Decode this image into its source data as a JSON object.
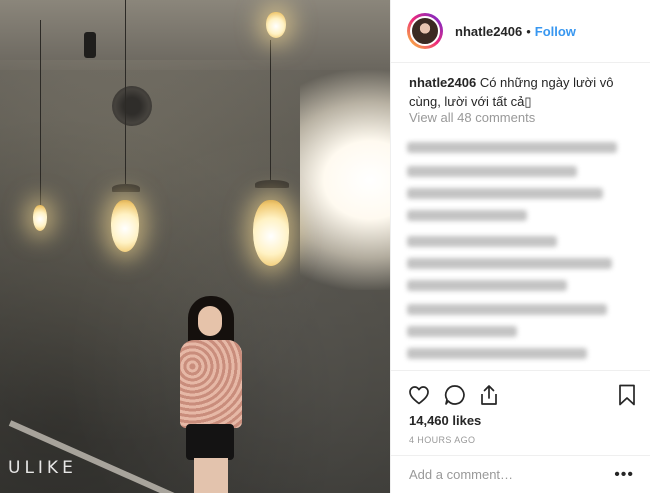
{
  "photo": {
    "watermark": "ULIKE"
  },
  "post": {
    "username": "nhatle2406",
    "separator": "•",
    "follow_label": "Follow",
    "caption_user": "nhatle2406",
    "caption_text": "Có những ngày lười vô cùng, lười với tất cả▯",
    "view_all_comments": "View all 48 comments",
    "likes": "14,460 likes",
    "posted_time": "4 HOURS AGO",
    "comment_placeholder": "Add a comment…",
    "more_label": "•••"
  },
  "icons": {
    "like": "heart-icon",
    "comment": "comment-bubble-icon",
    "share": "share-icon",
    "save": "bookmark-icon"
  },
  "colors": {
    "follow": "#3897f0",
    "muted": "#999999",
    "text": "#262626",
    "divider": "#efefef"
  }
}
